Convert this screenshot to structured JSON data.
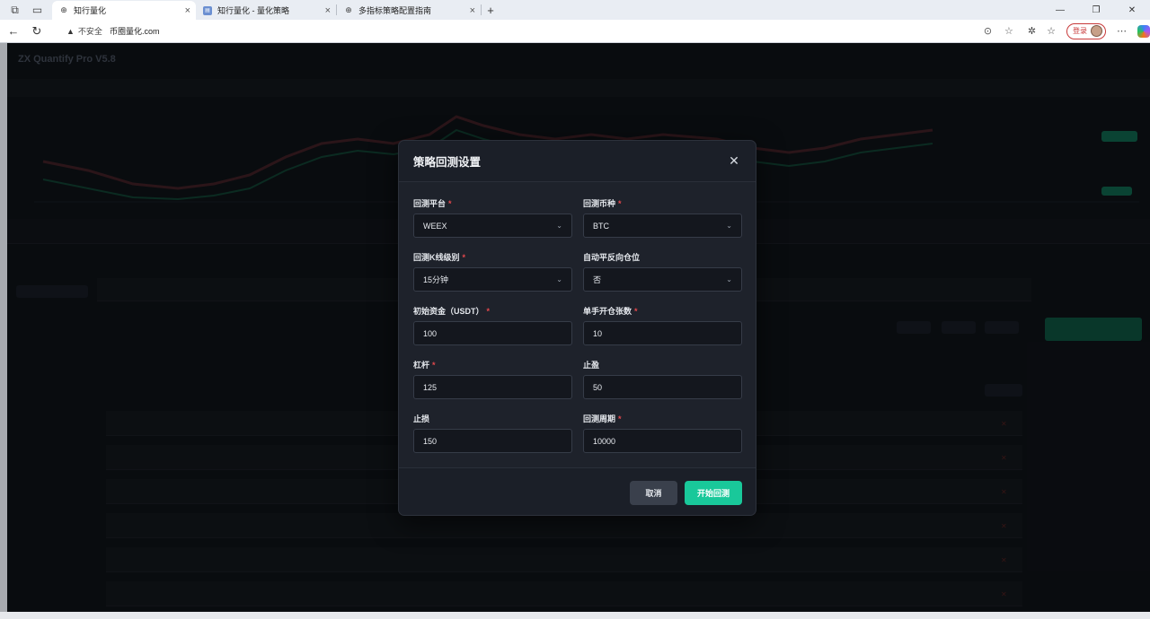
{
  "browser": {
    "tabs": [
      {
        "title": "知行量化",
        "active": true,
        "icon": "globe-icon"
      },
      {
        "title": "知行量化 - 量化策略",
        "active": false,
        "icon": "doc-icon"
      },
      {
        "title": "多指标策略配置指南",
        "active": false,
        "icon": "globe-icon"
      }
    ],
    "insecure_label": "不安全",
    "url": "币圈量化.com",
    "login_label": "登录"
  },
  "app": {
    "title": "ZX Quantify Pro V5.8"
  },
  "modal": {
    "title": "策略回测设置",
    "fields": {
      "platform": {
        "label": "回测平台",
        "value": "WEEX",
        "required": true
      },
      "symbol": {
        "label": "回测币种",
        "value": "BTC",
        "required": true
      },
      "kline": {
        "label": "回测K线级别",
        "value": "15分钟",
        "required": true
      },
      "auto_close": {
        "label": "自动平反向仓位",
        "value": "否",
        "required": false
      },
      "capital": {
        "label": "初始资金（USDT）",
        "value": "100",
        "required": true
      },
      "contracts": {
        "label": "单手开仓张数",
        "value": "10",
        "required": true
      },
      "leverage": {
        "label": "杠杆",
        "value": "125",
        "required": true
      },
      "take_profit": {
        "label": "止盈",
        "value": "50",
        "required": false
      },
      "stop_loss": {
        "label": "止损",
        "value": "150",
        "required": false
      },
      "period": {
        "label": "回测周期",
        "value": "10000",
        "required": true
      }
    },
    "cancel_label": "取消",
    "start_label": "开始回测"
  },
  "colors": {
    "accent": "#19c89a",
    "required": "#e5484d",
    "modal_bg": "#1b1f28"
  }
}
